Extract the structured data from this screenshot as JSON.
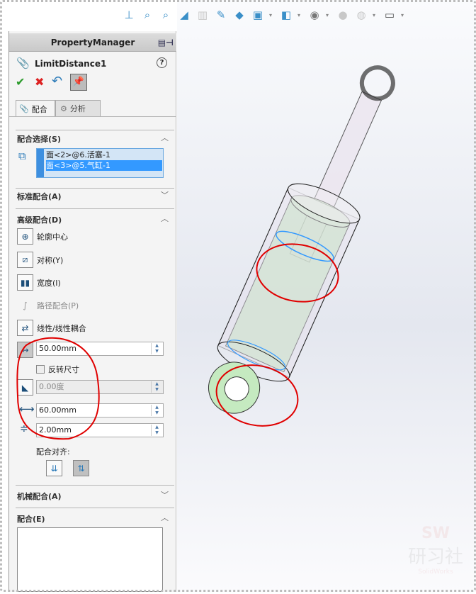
{
  "panel": {
    "header": "PropertyManager",
    "feature_name": "LimitDistance1",
    "tabs": [
      {
        "label": "配合"
      },
      {
        "label": "分析"
      }
    ],
    "mate_selections": {
      "title": "配合选择(S)",
      "items": [
        "面<2>@6.活塞-1",
        "面<3>@5.气缸-1"
      ],
      "selected_index": 1
    },
    "standard_mates": {
      "title": "标准配合(A)"
    },
    "advanced_mates": {
      "title": "高级配合(D)",
      "items": [
        {
          "label": "轮廓中心"
        },
        {
          "label": "对称(Y)"
        },
        {
          "label": "宽度(I)"
        },
        {
          "label": "路径配合(P)",
          "disabled": true
        },
        {
          "label": "线性/线性耦合"
        }
      ],
      "distance": "50.00mm",
      "flip_dimension": "反转尺寸",
      "flip_checked": false,
      "angle": "0.00度",
      "max_value": "60.00mm",
      "min_value": "2.00mm"
    },
    "mate_alignment": {
      "title": "配合对齐:"
    },
    "mechanical_mates": {
      "title": "机械配合(A)"
    },
    "mates": {
      "title": "配合(E)"
    }
  },
  "watermark": {
    "line1": "SW",
    "line2": "研习社",
    "line3": "SolidWorks"
  },
  "colors": {
    "selection": "#3399ff",
    "annotation": "#e00000",
    "part_green": "#bfe6bf"
  }
}
